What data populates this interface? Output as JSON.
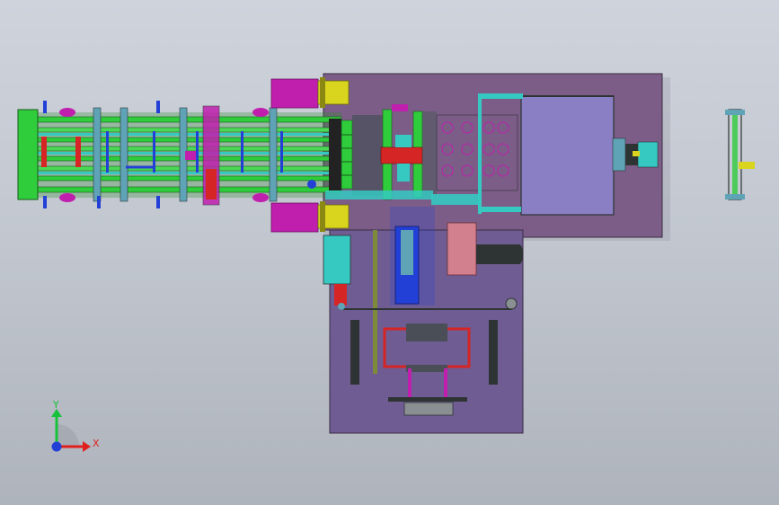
{
  "viewport": {
    "background_top": "#cfd3dc",
    "background_bottom": "#aeb3bc"
  },
  "model": {
    "colors": {
      "base_plate": "#7b5d87",
      "base_plate_edge": "#3b2d44",
      "lower_plate": "#6f5c92",
      "control_box": "#8a7ec4",
      "green_rails": "#2fcc3c",
      "cyan_parts": "#35c9c2",
      "magenta_cylinders": "#c01fae",
      "yellow_parts": "#d9d51e",
      "red_parts": "#d62525",
      "blue_parts": "#2340d6",
      "pink_box": "#d2808d",
      "dark_parts": "#2e3434"
    }
  },
  "triad": {
    "x_label": "X",
    "y_label": "Y",
    "x_color": "#e0201c",
    "y_color": "#17c23a",
    "z_color": "#2340d6"
  }
}
